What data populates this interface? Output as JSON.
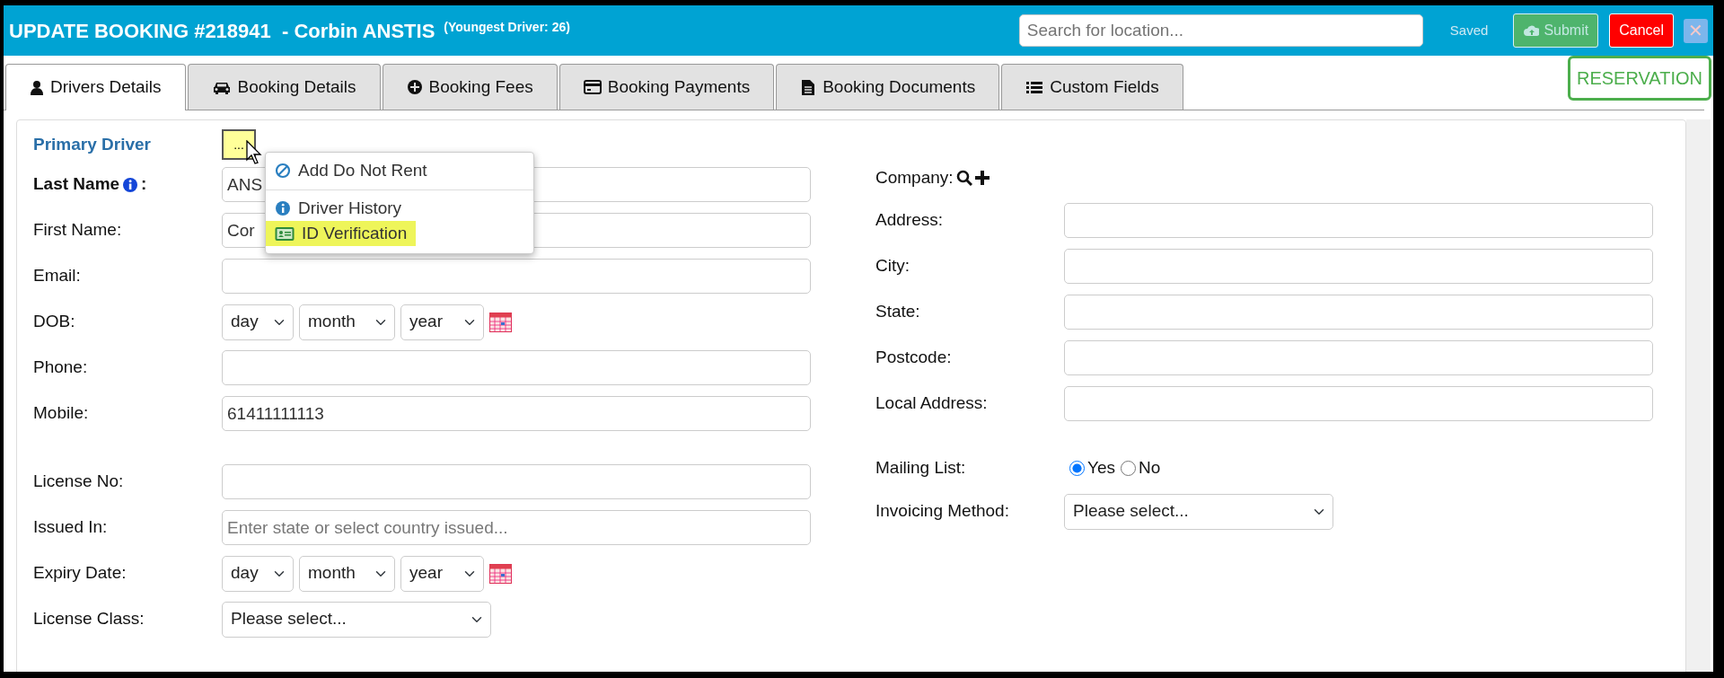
{
  "header": {
    "title": "UPDATE BOOKING #218941  - Corbin ANSTIS",
    "subtitle": "(Youngest Driver: 26)",
    "search": {
      "placeholder": "Search for location..."
    },
    "status": "Saved",
    "buttons": [
      {
        "kind": "submit",
        "label": "Submit",
        "disabled": true
      },
      {
        "kind": "cancel",
        "label": "Cancel"
      },
      {
        "kind": "close",
        "label": "✕"
      }
    ]
  },
  "tabs": [
    {
      "label": "Drivers Details",
      "selected": true
    },
    {
      "label": "Booking Details",
      "selected": false
    },
    {
      "label": "Booking Fees",
      "selected": false
    },
    {
      "label": "Booking Payments",
      "selected": false
    },
    {
      "label": "Booking Documents",
      "selected": false
    },
    {
      "label": "Custom Fields",
      "selected": false
    }
  ],
  "booking_type": "RESERVATION",
  "section": {
    "title": "Primary Driver",
    "menu_button": "...",
    "menu": [
      {
        "kind": "item",
        "label": "Add Do Not Rent",
        "highlighted": false
      },
      {
        "kind": "divider"
      },
      {
        "kind": "item",
        "label": "Driver History",
        "highlighted": false
      },
      {
        "kind": "item",
        "label": "ID Verification",
        "highlighted": true
      }
    ]
  },
  "contact_fields": [
    {
      "kind": "text",
      "label": "Last Name",
      "emphasized": true,
      "info": true,
      "label_suffix": ":",
      "value": "ANS"
    },
    {
      "kind": "text",
      "label": "First Name:",
      "emphasized": false,
      "info": false,
      "value": "Cor"
    },
    {
      "kind": "text",
      "label": "Email:",
      "emphasized": false,
      "info": false
    },
    {
      "kind": "date",
      "label": "DOB:",
      "emphasized": false,
      "info": false,
      "parts": [
        "day",
        "month",
        "year"
      ]
    },
    {
      "kind": "text",
      "label": "Phone:",
      "emphasized": false,
      "info": false
    },
    {
      "kind": "text",
      "label": "Mobile:",
      "emphasized": false,
      "info": false,
      "value": "61411111113"
    }
  ],
  "license_fields": [
    {
      "kind": "text",
      "label": "License No:",
      "emphasized": false,
      "info": false
    },
    {
      "kind": "text",
      "label": "Issued In:",
      "emphasized": false,
      "info": false,
      "placeholder": "Enter state or select country issued..."
    },
    {
      "kind": "date",
      "label": "Expiry Date:",
      "emphasized": false,
      "info": false,
      "parts": [
        "day",
        "month",
        "year"
      ]
    },
    {
      "kind": "select",
      "label": "License Class:",
      "emphasized": false,
      "info": false,
      "value": "Please select..."
    }
  ],
  "address_fields": [
    {
      "kind": "company",
      "label": "Company:"
    },
    {
      "kind": "text",
      "label": "Address:"
    },
    {
      "kind": "text",
      "label": "City:"
    },
    {
      "kind": "text",
      "label": "State:"
    },
    {
      "kind": "text",
      "label": "Postcode:"
    },
    {
      "kind": "text",
      "label": "Local Address:"
    }
  ],
  "preference_fields": [
    {
      "kind": "radio",
      "label": "Mailing List:",
      "options": [
        {
          "label": "Yes",
          "selected": true
        },
        {
          "label": "No",
          "selected": false
        }
      ]
    },
    {
      "kind": "select",
      "label": "Invoicing Method:",
      "value": "Please select..."
    }
  ]
}
